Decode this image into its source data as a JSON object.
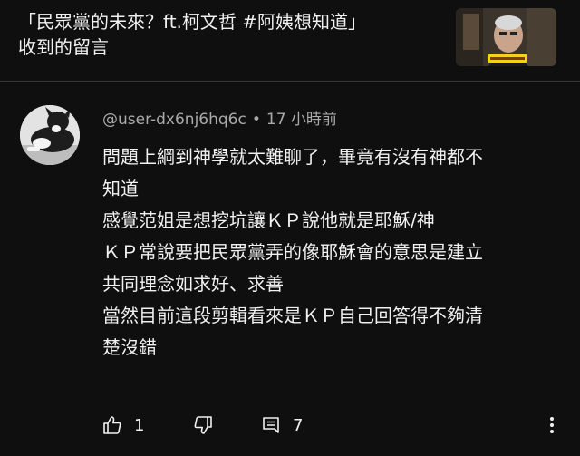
{
  "header": {
    "title_line1": "「民眾黨的未來？ft.柯文哲 #阿姨想知道」",
    "title_line2": "收到的留言"
  },
  "comment": {
    "author": "@user-dx6nj6hq6c",
    "separator": "•",
    "time": "17 小時前",
    "lines": [
      "問題上綱到神學就太難聊了，畢竟有沒有神都不",
      "知道",
      "感覺范姐是想挖坑讓ＫＰ說他就是耶穌/神",
      "ＫＰ常說要把民眾黨弄的像耶穌會的意思是建立",
      "共同理念如求好、求善",
      "當然目前這段剪輯看來是ＫＰ自己回答得不夠清",
      "楚沒錯"
    ],
    "like_count": "1",
    "reply_count": "7"
  },
  "colors": {
    "background": "#0f0f0f",
    "text_primary": "#f1f1f1",
    "text_secondary": "#aaaaaa"
  },
  "icons": {
    "like": "thumbs-up-icon",
    "dislike": "thumbs-down-icon",
    "reply": "reply-comment-icon",
    "more": "more-vertical-icon"
  }
}
